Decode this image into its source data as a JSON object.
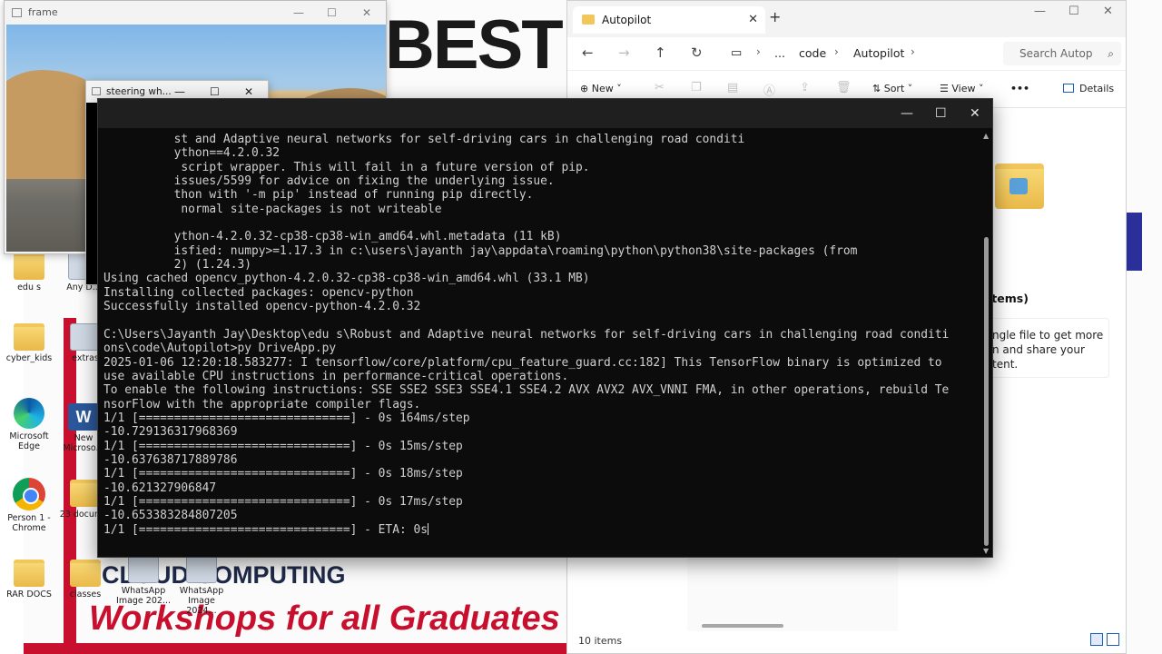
{
  "desktop": {
    "banner": {
      "best": "BEST",
      "cloud": "CLOUD COMPUTING",
      "workshops": "Workshops for all Graduates"
    },
    "icons": [
      {
        "label": "edu s",
        "kind": "folder"
      },
      {
        "label": "Any D...",
        "kind": "img"
      },
      {
        "label": "cyber_kids",
        "kind": "folder"
      },
      {
        "label": "extras",
        "kind": "img"
      },
      {
        "label": "Microsoft Edge",
        "kind": "edge"
      },
      {
        "label": "New Microso...",
        "kind": "word"
      },
      {
        "label": "Person 1 - Chrome",
        "kind": "chrome"
      },
      {
        "label": "23 docum...",
        "kind": "folder"
      },
      {
        "label": "RAR DOCS",
        "kind": "folder"
      },
      {
        "label": "classes",
        "kind": "folder"
      },
      {
        "label": "WhatsApp Image 202...",
        "kind": "img"
      },
      {
        "label": "WhatsApp Image 2024...",
        "kind": "img"
      }
    ]
  },
  "frame_window": {
    "title": "frame",
    "controls": [
      "—",
      "☐",
      "✕"
    ]
  },
  "steer_window": {
    "title": "steering wh...",
    "controls": [
      "—",
      "☐",
      "✕"
    ]
  },
  "explorer": {
    "tab_title": "Autopilot",
    "tab_close": "✕",
    "new_tab": "+",
    "window_controls": [
      "—",
      "☐",
      "✕"
    ],
    "nav": {
      "back": "←",
      "forward": "→",
      "up": "↑",
      "refresh": "↻"
    },
    "breadcrumb": [
      "...",
      "code",
      "Autopilot"
    ],
    "search_placeholder": "Search Autop",
    "commands": {
      "new": "New",
      "sort": "Sort",
      "view": "View",
      "more": "•••",
      "details": "Details"
    },
    "details": {
      "heading": "items)",
      "body_lines": [
        "ngle file to get more",
        "n and share your",
        "tent."
      ]
    },
    "status": "10 items"
  },
  "terminal": {
    "controls": [
      "—",
      "☐",
      "✕"
    ],
    "lines": [
      "          st and Adaptive neural networks for self-driving cars in challenging road conditi",
      "          ython==4.2.0.32",
      "           script wrapper. This will fail in a future version of pip.",
      "          issues/5599 for advice on fixing the underlying issue.",
      "          thon with '-m pip' instead of running pip directly.",
      "           normal site-packages is not writeable",
      "",
      "          ython-4.2.0.32-cp38-cp38-win_amd64.whl.metadata (11 kB)",
      "          isfied: numpy>=1.17.3 in c:\\users\\jayanth jay\\appdata\\roaming\\python\\python38\\site-packages (from",
      "          2) (1.24.3)",
      "Using cached opencv_python-4.2.0.32-cp38-cp38-win_amd64.whl (33.1 MB)",
      "Installing collected packages: opencv-python",
      "Successfully installed opencv-python-4.2.0.32",
      "",
      "C:\\Users\\Jayanth Jay\\Desktop\\edu s\\Robust and Adaptive neural networks for self-driving cars in challenging road conditi",
      "ons\\code\\Autopilot>py DriveApp.py",
      "2025-01-06 12:20:18.583277: I tensorflow/core/platform/cpu_feature_guard.cc:182] This TensorFlow binary is optimized to",
      "use available CPU instructions in performance-critical operations.",
      "To enable the following instructions: SSE SSE2 SSE3 SSE4.1 SSE4.2 AVX AVX2 AVX_VNNI FMA, in other operations, rebuild Te",
      "nsorFlow with the appropriate compiler flags.",
      "1/1 [==============================] - 0s 164ms/step",
      "-10.729136317968369",
      "1/1 [==============================] - 0s 15ms/step",
      "-10.637638717889786",
      "1/1 [==============================] - 0s 18ms/step",
      "-10.621327906847",
      "1/1 [==============================] - 0s 17ms/step",
      "-10.653383284807205",
      "1/1 [==============================] - ETA: 0s"
    ]
  }
}
